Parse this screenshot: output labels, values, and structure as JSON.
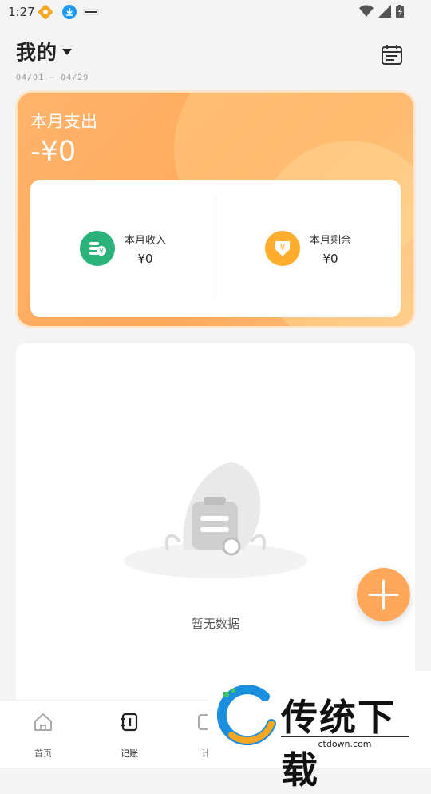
{
  "status_bar": {
    "time": "1:27"
  },
  "header": {
    "title": "我的",
    "date_range": "04/01 ~ 04/29"
  },
  "summary": {
    "expense_label": "本月支出",
    "expense_value": "-¥0",
    "income_label": "本月收入",
    "income_value": "¥0",
    "remaining_label": "本月剩余",
    "remaining_value": "¥0",
    "colors": {
      "income": "#2ab27b",
      "remaining": "#ffad2e",
      "card": "#ffa95c"
    }
  },
  "list": {
    "empty_text": "暂无数据"
  },
  "bottom_nav": {
    "items": [
      {
        "label": "首页",
        "icon": "home-icon"
      },
      {
        "label": "记账",
        "icon": "notebook-icon"
      },
      {
        "label": "计",
        "icon": "chart-icon"
      }
    ]
  },
  "watermark": {
    "brand": "传统下载",
    "site": "ctdown.com"
  }
}
